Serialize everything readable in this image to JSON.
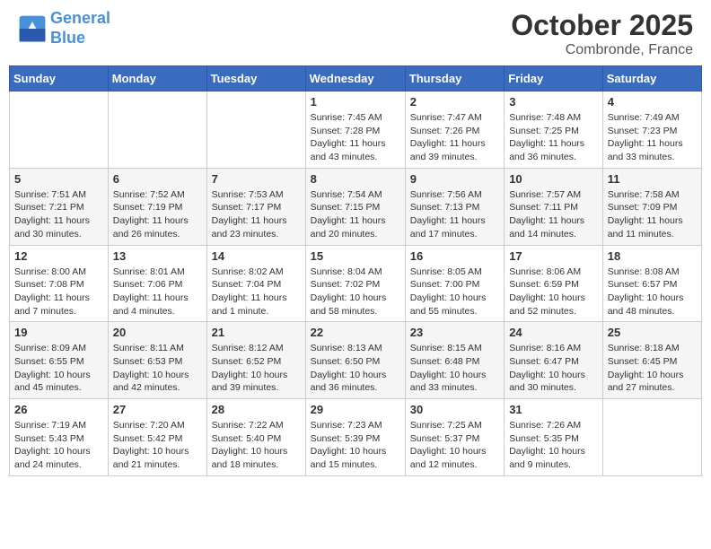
{
  "header": {
    "logo_line1": "General",
    "logo_line2": "Blue",
    "month": "October 2025",
    "location": "Combronde, France"
  },
  "weekdays": [
    "Sunday",
    "Monday",
    "Tuesday",
    "Wednesday",
    "Thursday",
    "Friday",
    "Saturday"
  ],
  "weeks": [
    [
      {
        "day": "",
        "info": ""
      },
      {
        "day": "",
        "info": ""
      },
      {
        "day": "",
        "info": ""
      },
      {
        "day": "1",
        "info": "Sunrise: 7:45 AM\nSunset: 7:28 PM\nDaylight: 11 hours\nand 43 minutes."
      },
      {
        "day": "2",
        "info": "Sunrise: 7:47 AM\nSunset: 7:26 PM\nDaylight: 11 hours\nand 39 minutes."
      },
      {
        "day": "3",
        "info": "Sunrise: 7:48 AM\nSunset: 7:25 PM\nDaylight: 11 hours\nand 36 minutes."
      },
      {
        "day": "4",
        "info": "Sunrise: 7:49 AM\nSunset: 7:23 PM\nDaylight: 11 hours\nand 33 minutes."
      }
    ],
    [
      {
        "day": "5",
        "info": "Sunrise: 7:51 AM\nSunset: 7:21 PM\nDaylight: 11 hours\nand 30 minutes."
      },
      {
        "day": "6",
        "info": "Sunrise: 7:52 AM\nSunset: 7:19 PM\nDaylight: 11 hours\nand 26 minutes."
      },
      {
        "day": "7",
        "info": "Sunrise: 7:53 AM\nSunset: 7:17 PM\nDaylight: 11 hours\nand 23 minutes."
      },
      {
        "day": "8",
        "info": "Sunrise: 7:54 AM\nSunset: 7:15 PM\nDaylight: 11 hours\nand 20 minutes."
      },
      {
        "day": "9",
        "info": "Sunrise: 7:56 AM\nSunset: 7:13 PM\nDaylight: 11 hours\nand 17 minutes."
      },
      {
        "day": "10",
        "info": "Sunrise: 7:57 AM\nSunset: 7:11 PM\nDaylight: 11 hours\nand 14 minutes."
      },
      {
        "day": "11",
        "info": "Sunrise: 7:58 AM\nSunset: 7:09 PM\nDaylight: 11 hours\nand 11 minutes."
      }
    ],
    [
      {
        "day": "12",
        "info": "Sunrise: 8:00 AM\nSunset: 7:08 PM\nDaylight: 11 hours\nand 7 minutes."
      },
      {
        "day": "13",
        "info": "Sunrise: 8:01 AM\nSunset: 7:06 PM\nDaylight: 11 hours\nand 4 minutes."
      },
      {
        "day": "14",
        "info": "Sunrise: 8:02 AM\nSunset: 7:04 PM\nDaylight: 11 hours\nand 1 minute."
      },
      {
        "day": "15",
        "info": "Sunrise: 8:04 AM\nSunset: 7:02 PM\nDaylight: 10 hours\nand 58 minutes."
      },
      {
        "day": "16",
        "info": "Sunrise: 8:05 AM\nSunset: 7:00 PM\nDaylight: 10 hours\nand 55 minutes."
      },
      {
        "day": "17",
        "info": "Sunrise: 8:06 AM\nSunset: 6:59 PM\nDaylight: 10 hours\nand 52 minutes."
      },
      {
        "day": "18",
        "info": "Sunrise: 8:08 AM\nSunset: 6:57 PM\nDaylight: 10 hours\nand 48 minutes."
      }
    ],
    [
      {
        "day": "19",
        "info": "Sunrise: 8:09 AM\nSunset: 6:55 PM\nDaylight: 10 hours\nand 45 minutes."
      },
      {
        "day": "20",
        "info": "Sunrise: 8:11 AM\nSunset: 6:53 PM\nDaylight: 10 hours\nand 42 minutes."
      },
      {
        "day": "21",
        "info": "Sunrise: 8:12 AM\nSunset: 6:52 PM\nDaylight: 10 hours\nand 39 minutes."
      },
      {
        "day": "22",
        "info": "Sunrise: 8:13 AM\nSunset: 6:50 PM\nDaylight: 10 hours\nand 36 minutes."
      },
      {
        "day": "23",
        "info": "Sunrise: 8:15 AM\nSunset: 6:48 PM\nDaylight: 10 hours\nand 33 minutes."
      },
      {
        "day": "24",
        "info": "Sunrise: 8:16 AM\nSunset: 6:47 PM\nDaylight: 10 hours\nand 30 minutes."
      },
      {
        "day": "25",
        "info": "Sunrise: 8:18 AM\nSunset: 6:45 PM\nDaylight: 10 hours\nand 27 minutes."
      }
    ],
    [
      {
        "day": "26",
        "info": "Sunrise: 7:19 AM\nSunset: 5:43 PM\nDaylight: 10 hours\nand 24 minutes."
      },
      {
        "day": "27",
        "info": "Sunrise: 7:20 AM\nSunset: 5:42 PM\nDaylight: 10 hours\nand 21 minutes."
      },
      {
        "day": "28",
        "info": "Sunrise: 7:22 AM\nSunset: 5:40 PM\nDaylight: 10 hours\nand 18 minutes."
      },
      {
        "day": "29",
        "info": "Sunrise: 7:23 AM\nSunset: 5:39 PM\nDaylight: 10 hours\nand 15 minutes."
      },
      {
        "day": "30",
        "info": "Sunrise: 7:25 AM\nSunset: 5:37 PM\nDaylight: 10 hours\nand 12 minutes."
      },
      {
        "day": "31",
        "info": "Sunrise: 7:26 AM\nSunset: 5:35 PM\nDaylight: 10 hours\nand 9 minutes."
      },
      {
        "day": "",
        "info": ""
      }
    ]
  ]
}
